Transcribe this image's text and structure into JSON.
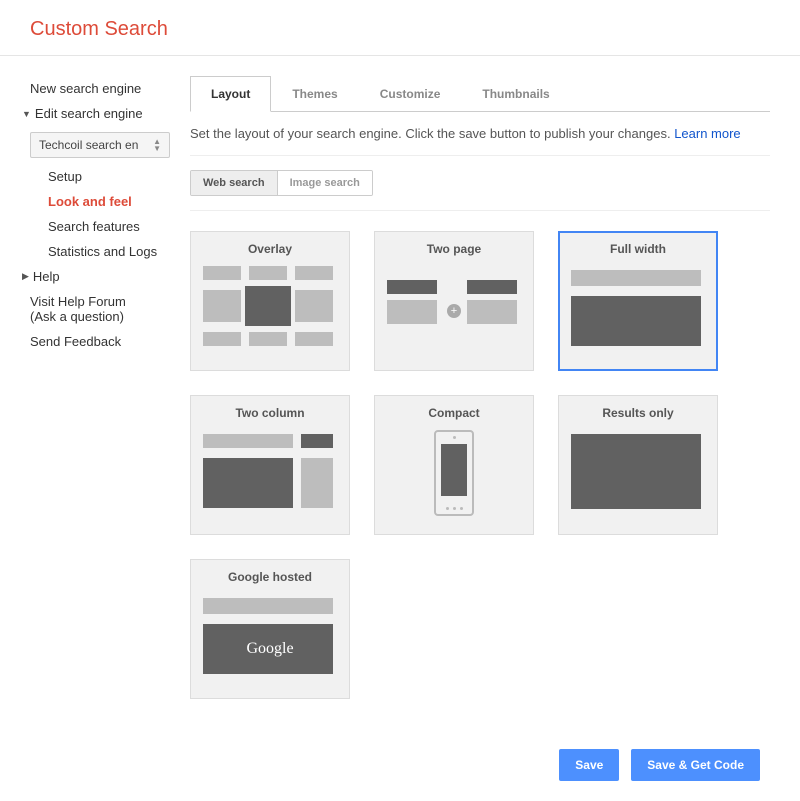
{
  "header": {
    "title": "Custom Search"
  },
  "sidebar": {
    "new_engine": "New search engine",
    "edit_engine": "Edit search engine",
    "engine_name": "Techcoil search en",
    "items": {
      "setup": "Setup",
      "look_feel": "Look and feel",
      "search_features": "Search features",
      "stats": "Statistics and Logs"
    },
    "help": "Help",
    "visit_forum": "Visit Help Forum",
    "ask_question": "(Ask a question)",
    "send_feedback": "Send Feedback"
  },
  "tabs": {
    "layout": "Layout",
    "themes": "Themes",
    "customize": "Customize",
    "thumbnails": "Thumbnails"
  },
  "description": "Set the layout of your search engine. Click the save button to publish your changes. ",
  "learn_more": "Learn more",
  "subtabs": {
    "web": "Web search",
    "image": "Image search"
  },
  "layouts": {
    "overlay": "Overlay",
    "two_page": "Two page",
    "full_width": "Full width",
    "two_column": "Two column",
    "compact": "Compact",
    "results_only": "Results only",
    "google_hosted": "Google hosted"
  },
  "google_brand": "Google",
  "buttons": {
    "save": "Save",
    "save_get_code": "Save & Get Code"
  }
}
